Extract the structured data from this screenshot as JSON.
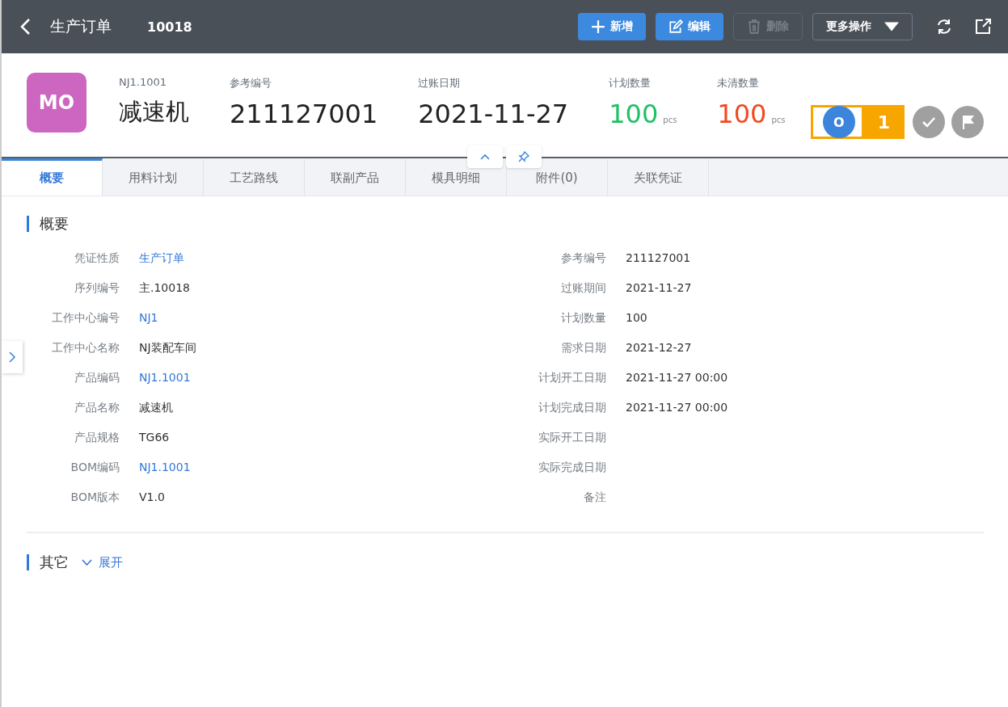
{
  "header": {
    "title": "生产订单",
    "number": "10018",
    "buttons": [
      {
        "kind": "add",
        "label": "新增",
        "disabled": false
      },
      {
        "kind": "edit",
        "label": "编辑",
        "disabled": false
      },
      {
        "kind": "delete",
        "label": "删除",
        "disabled": true
      },
      {
        "kind": "more",
        "label": "更多操作",
        "disabled": false
      }
    ]
  },
  "summary": {
    "avatar": "MO",
    "code": "NJ1.1001",
    "name": "减速机",
    "stats": [
      {
        "label": "参考编号",
        "value": "211127001"
      },
      {
        "label": "过账日期",
        "value": "2021-11-27"
      },
      {
        "label": "计划数量",
        "value": "100",
        "unit": "pcs",
        "color": "#1ec163"
      },
      {
        "label": "未清数量",
        "value": "100",
        "unit": "pcs",
        "color": "#f04a22"
      }
    ],
    "steps": [
      {
        "kind": "open",
        "label": "O",
        "selected": true
      },
      {
        "kind": "approved",
        "selected": false
      },
      {
        "kind": "closed",
        "selected": false
      }
    ],
    "callout": "1"
  },
  "tabs": [
    {
      "label": "概要",
      "selected": true
    },
    {
      "label": "用料计划",
      "selected": false
    },
    {
      "label": "工艺路线",
      "selected": false
    },
    {
      "label": "联副产品",
      "selected": false
    },
    {
      "label": "模具明细",
      "selected": false
    },
    {
      "label": "附件(0)",
      "selected": false
    },
    {
      "label": "关联凭证",
      "selected": false
    }
  ],
  "overview": {
    "title": "概要",
    "left": [
      {
        "label": "凭证性质",
        "value": "生产订单",
        "link": true
      },
      {
        "label": "序列编号",
        "value": "主.10018",
        "link": false
      },
      {
        "label": "工作中心编号",
        "value": "NJ1",
        "link": true
      },
      {
        "label": "工作中心名称",
        "value": "NJ装配车间",
        "link": false
      },
      {
        "label": "产品编码",
        "value": "NJ1.1001",
        "link": true
      },
      {
        "label": "产品名称",
        "value": "减速机",
        "link": false
      },
      {
        "label": "产品规格",
        "value": "TG66",
        "link": false
      },
      {
        "label": "BOM编码",
        "value": "NJ1.1001",
        "link": true
      },
      {
        "label": "BOM版本",
        "value": "V1.0",
        "link": false
      }
    ],
    "right": [
      {
        "label": "参考编号",
        "value": "211127001",
        "link": false
      },
      {
        "label": "过账期间",
        "value": "2021-11-27",
        "link": false
      },
      {
        "label": "计划数量",
        "value": "100",
        "link": false
      },
      {
        "label": "需求日期",
        "value": "2021-12-27",
        "link": false
      },
      {
        "label": "计划开工日期",
        "value": "2021-11-27 00:00",
        "link": false
      },
      {
        "label": "计划完成日期",
        "value": "2021-11-27 00:00",
        "link": false
      },
      {
        "label": "实际开工日期"
      },
      {
        "label": "实际完成日期"
      },
      {
        "label": "备注"
      }
    ]
  },
  "other": {
    "title": "其它",
    "toggle": "展开",
    "expanded": false
  }
}
